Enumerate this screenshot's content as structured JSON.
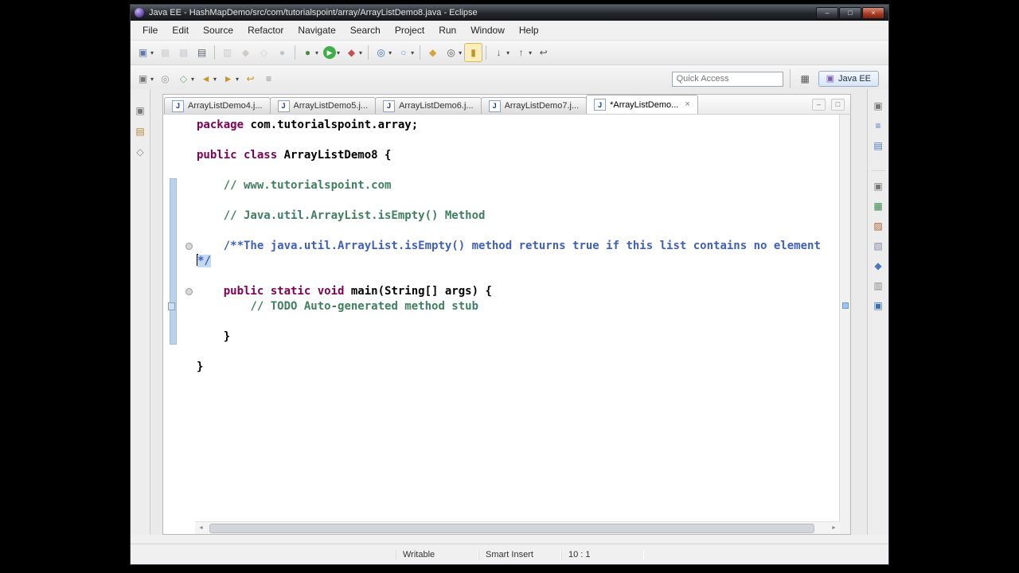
{
  "window": {
    "title": "Java EE - HashMapDemo/src/com/tutorialspoint/array/ArrayListDemo8.java - Eclipse",
    "controls": [
      {
        "name": "minimize-button",
        "glyph": "–"
      },
      {
        "name": "maximize-button",
        "glyph": "□"
      },
      {
        "name": "close-button",
        "glyph": "×"
      }
    ]
  },
  "menu": {
    "items": [
      "File",
      "Edit",
      "Source",
      "Refactor",
      "Navigate",
      "Search",
      "Project",
      "Run",
      "Window",
      "Help"
    ]
  },
  "toolbar": {
    "dropdown_glyph": "▾",
    "quick_access_placeholder": "Quick Access",
    "open_perspective_glyph": "▦",
    "perspective_icon_glyph": "▣",
    "perspective_label": "Java EE",
    "row1": [
      {
        "name": "new-wizard-button",
        "glyph": "▣",
        "color": "#5b79ad",
        "dropdown": true
      },
      {
        "name": "save-button",
        "glyph": "▦",
        "color": "#9193b8",
        "disabled": true
      },
      {
        "name": "save-all-button",
        "glyph": "▩",
        "color": "#9193b8",
        "disabled": true
      },
      {
        "name": "print-button",
        "glyph": "▤",
        "color": "#5e6673"
      },
      {
        "sep": true
      },
      {
        "name": "build-all-button",
        "glyph": "▥",
        "color": "#8a8a8a",
        "disabled": true
      },
      {
        "name": "new-java-ee-project-button",
        "glyph": "◆",
        "color": "#b08c3a",
        "disabled": true
      },
      {
        "name": "new-servlet-button",
        "glyph": "◇",
        "color": "#8a8fae",
        "disabled": true
      },
      {
        "name": "new-class-button",
        "glyph": "●",
        "color": "#4a7ab0",
        "disabled": true
      },
      {
        "sep": true
      },
      {
        "name": "debug-button",
        "glyph": "●",
        "color": "#4a8a3a",
        "dropdown": true
      },
      {
        "name": "run-button",
        "glyph": "▶",
        "color": "#ffffff",
        "bg": "#3fae49",
        "dropdown": true
      },
      {
        "name": "external-tools-button",
        "glyph": "◆",
        "color": "#c0504d",
        "dropdown": true
      },
      {
        "sep": true
      },
      {
        "name": "web-service-button",
        "glyph": "◎",
        "color": "#3a6fb0",
        "dropdown": true
      },
      {
        "name": "new-web-service-client-button",
        "glyph": "○",
        "color": "#6a9ad0",
        "dropdown": true
      },
      {
        "sep": true
      },
      {
        "name": "open-type-button",
        "glyph": "◆",
        "color": "#d8a433"
      },
      {
        "name": "search-button",
        "glyph": "◎",
        "color": "#555555",
        "dropdown": true
      },
      {
        "name": "mark-occurrences-toggle",
        "glyph": "▮",
        "color": "#b8952d",
        "active": true
      },
      {
        "sep": true
      },
      {
        "name": "next-annotation-button",
        "glyph": "↓",
        "color": "#555555",
        "dropdown": true
      },
      {
        "name": "previous-annotation-button",
        "glyph": "↑",
        "color": "#555555",
        "dropdown": true
      },
      {
        "name": "last-edit-location-button",
        "glyph": "↩",
        "color": "#555555"
      }
    ],
    "row2": [
      {
        "name": "open-type-hierarchy-button",
        "glyph": "▣",
        "color": "#777777",
        "dropdown": true
      },
      {
        "name": "pin-editor-button",
        "glyph": "◎",
        "color": "#999999"
      },
      {
        "name": "new-java-element-button",
        "glyph": "◇",
        "color": "#77aa88",
        "dropdown": true
      },
      {
        "name": "back-button",
        "glyph": "◄",
        "color": "#c8951f",
        "dropdown": true
      },
      {
        "name": "forward-button",
        "glyph": "►",
        "color": "#c8951f",
        "dropdown": true
      },
      {
        "name": "last-edit-nav-button",
        "glyph": "↩",
        "color": "#c8951f"
      },
      {
        "name": "link-with-editor-button",
        "glyph": "≡",
        "color": "#888888"
      }
    ]
  },
  "rails": {
    "left": [
      {
        "name": "restore-left-panel-button",
        "glyph": "▣",
        "color": "#777777"
      },
      {
        "name": "project-explorer-button",
        "glyph": "▤",
        "color": "#b08c3a"
      },
      {
        "name": "navigator-button",
        "glyph": "◇",
        "color": "#888888"
      }
    ],
    "right_top": [
      {
        "name": "restore-right-panel-button",
        "glyph": "▣",
        "color": "#777777"
      },
      {
        "name": "outline-button",
        "glyph": "≡",
        "color": "#4a78c0"
      },
      {
        "name": "task-list-button",
        "glyph": "▤",
        "color": "#4a78c0"
      }
    ],
    "right_bottom": [
      {
        "name": "restore-bottom-panel-button",
        "glyph": "▣",
        "color": "#777777"
      },
      {
        "name": "servers-button",
        "glyph": "▦",
        "color": "#3a8a4a"
      },
      {
        "name": "data-source-explorer-button",
        "glyph": "▨",
        "color": "#b06030"
      },
      {
        "name": "snippets-button",
        "glyph": "▧",
        "color": "#8888aa"
      },
      {
        "name": "markers-button",
        "glyph": "◆",
        "color": "#4a78c0"
      },
      {
        "name": "properties-button",
        "glyph": "▥",
        "color": "#888888"
      },
      {
        "name": "console-button",
        "glyph": "▣",
        "color": "#3a6fb0"
      }
    ]
  },
  "editor": {
    "tabs": [
      {
        "label": "ArrayListDemo4.j...",
        "icon": "J",
        "active": false
      },
      {
        "label": "ArrayListDemo5.j...",
        "icon": "J",
        "active": false
      },
      {
        "label": "ArrayListDemo6.j...",
        "icon": "J",
        "active": false
      },
      {
        "label": "ArrayListDemo7.j...",
        "icon": "J",
        "active": false
      },
      {
        "label": "*ArrayListDemo...",
        "icon": "J",
        "active": true
      }
    ],
    "tab_close_glyph": "×",
    "tab_actions": [
      {
        "name": "minimize-view-button",
        "glyph": "–"
      },
      {
        "name": "maximize-view-button",
        "glyph": "□"
      }
    ],
    "scrollbar": {
      "left_arrow_glyph": "◄",
      "right_arrow_glyph": "►"
    },
    "colors": {
      "kw": "#7f0055",
      "def": "#000000",
      "com": "#3f7f5f",
      "doc": "#3f5fbf",
      "selection_bg": "#c3d9f0",
      "default": "#000000"
    },
    "annotations": {
      "range_start_line": 5,
      "range_end_line": 15,
      "fold_lines": [
        9,
        12
      ],
      "task_line": 13,
      "overview_marker_line": 13
    },
    "code_lines": [
      {
        "segs": [
          {
            "c": "kw",
            "t": "package "
          },
          {
            "c": "def",
            "t": "com.tutorialspoint.array;"
          }
        ]
      },
      {
        "segs": []
      },
      {
        "segs": [
          {
            "c": "kw",
            "t": "public class "
          },
          {
            "c": "def",
            "t": "ArrayListDemo8 {"
          }
        ]
      },
      {
        "segs": []
      },
      {
        "segs": [
          {
            "c": "def",
            "t": "    "
          },
          {
            "c": "com",
            "t": "// www.tutorialspoint.com"
          }
        ]
      },
      {
        "segs": []
      },
      {
        "segs": [
          {
            "c": "def",
            "t": "    "
          },
          {
            "c": "com",
            "t": "// Java.util.ArrayList.isEmpty() Method"
          }
        ]
      },
      {
        "segs": []
      },
      {
        "segs": [
          {
            "c": "def",
            "t": "    "
          },
          {
            "c": "doc",
            "t": "/**The java.util.ArrayList.isEmpty() method returns true if this list contains no element"
          }
        ]
      },
      {
        "cursor": true,
        "segs": [
          {
            "c": "doc",
            "t": "*/",
            "sel": true
          }
        ]
      },
      {
        "segs": []
      },
      {
        "segs": [
          {
            "c": "def",
            "t": "    "
          },
          {
            "c": "kw",
            "t": "public static void "
          },
          {
            "c": "def",
            "t": "main(String[] args) {"
          }
        ]
      },
      {
        "segs": [
          {
            "c": "def",
            "t": "        "
          },
          {
            "c": "com",
            "t": "// TODO Auto-generated method stub"
          }
        ]
      },
      {
        "segs": []
      },
      {
        "segs": [
          {
            "c": "def",
            "t": "    }"
          }
        ]
      },
      {
        "segs": []
      },
      {
        "segs": [
          {
            "c": "def",
            "t": "}"
          }
        ]
      }
    ]
  },
  "status": {
    "writable": "Writable",
    "insert_mode": "Smart Insert",
    "cursor_position": "10 : 1"
  }
}
